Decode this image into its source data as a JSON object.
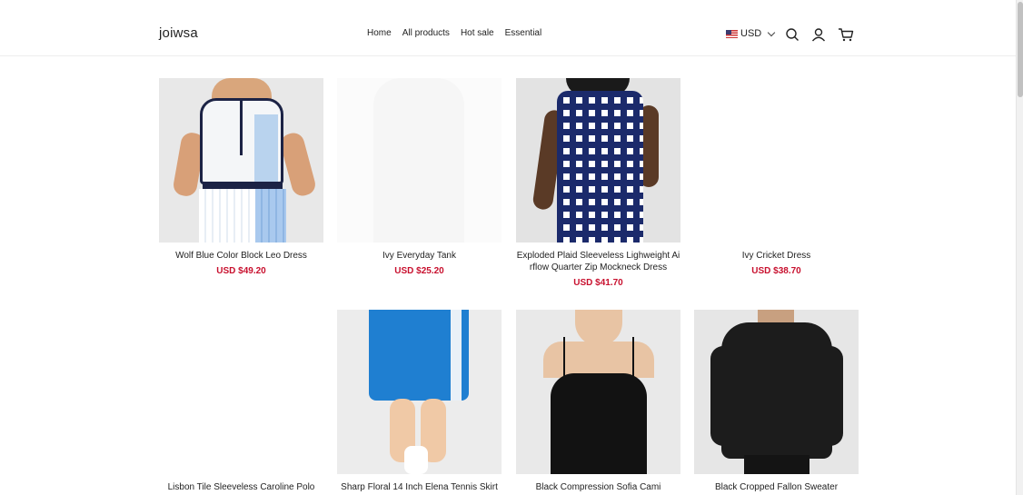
{
  "header": {
    "logo": "joiwsa",
    "nav": [
      "Home",
      "All products",
      "Hot sale",
      "Essential"
    ],
    "currency": "USD"
  },
  "products": [
    {
      "name": "Wolf Blue Color Block Leo Dress",
      "price": "USD $49.20"
    },
    {
      "name": "Ivy Everyday Tank",
      "price": "USD $25.20"
    },
    {
      "name": "Exploded Plaid Sleeveless Lighweight Ai\nrflow Quarter Zip Mockneck Dress",
      "price": "USD $41.70"
    },
    {
      "name": "Ivy Cricket Dress",
      "price": "USD $38.70"
    },
    {
      "name": "Lisbon Tile Sleeveless Caroline Polo",
      "price": ""
    },
    {
      "name": "Sharp Floral 14 Inch Elena Tennis Skirt",
      "price": ""
    },
    {
      "name": "Black Compression Sofia Cami",
      "price": ""
    },
    {
      "name": "Black Cropped Fallon Sweater",
      "price": ""
    }
  ],
  "colors": {
    "price": "#c8102e",
    "text": "#222222",
    "divider": "#eeeeee"
  },
  "icons": [
    "flag-us-icon",
    "chevron-down-icon",
    "search-icon",
    "user-icon",
    "cart-icon"
  ]
}
